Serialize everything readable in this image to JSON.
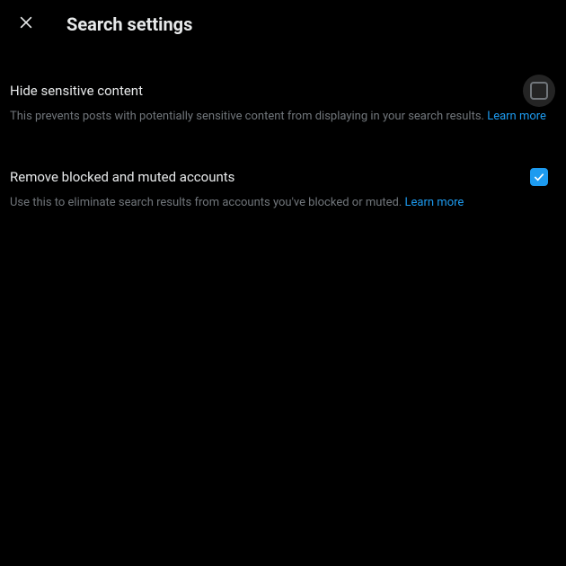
{
  "header": {
    "title": "Search settings"
  },
  "settings": {
    "hideSensitive": {
      "title": "Hide sensitive content",
      "description": "This prevents posts with potentially sensitive content from displaying in your search results. ",
      "learnMore": "Learn more",
      "checked": false
    },
    "removeBlocked": {
      "title": "Remove blocked and muted accounts",
      "description": "Use this to eliminate search results from accounts you've blocked or muted. ",
      "learnMore": "Learn more",
      "checked": true
    }
  },
  "colors": {
    "accent": "#1d9bf0",
    "textPrimary": "#e7e9ea",
    "textSecondary": "#71767b",
    "background": "#000000"
  }
}
